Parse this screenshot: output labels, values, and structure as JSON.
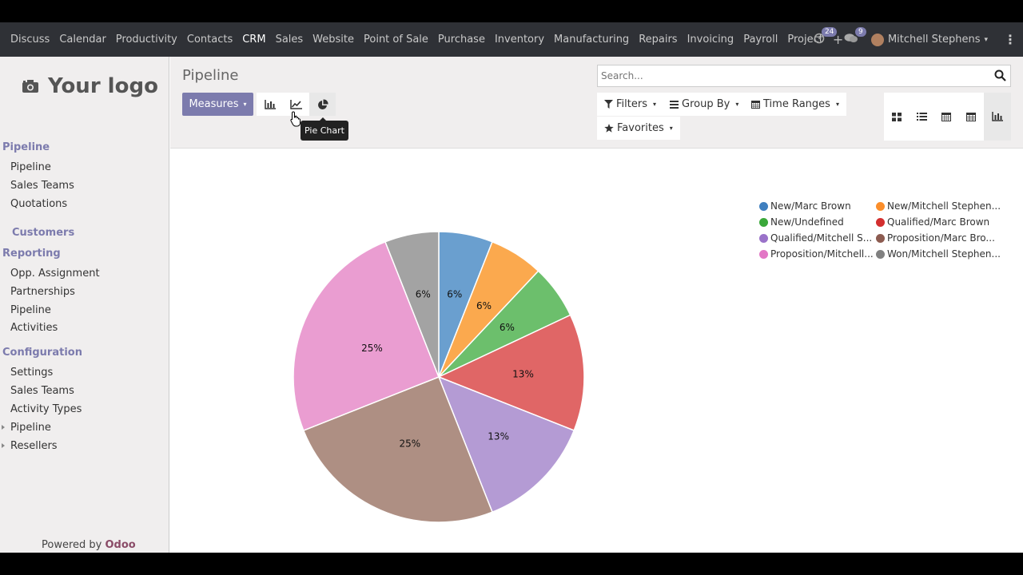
{
  "nav": {
    "menu": [
      "Discuss",
      "Calendar",
      "Productivity",
      "Contacts",
      "CRM",
      "Sales",
      "Website",
      "Point of Sale",
      "Purchase",
      "Inventory",
      "Manufacturing",
      "Repairs",
      "Invoicing",
      "Payroll",
      "Project"
    ],
    "active": "CRM",
    "plus_label": "+",
    "activity_count": "24",
    "message_count": "9",
    "user_name": "Mitchell Stephens",
    "caret": "▾",
    "more": "⋮"
  },
  "sidebar": {
    "logo_text": "Your logo",
    "sections": [
      {
        "label": "Pipeline",
        "items": [
          "Pipeline",
          "Sales Teams",
          "Quotations"
        ]
      },
      {
        "label": "Customers",
        "items": []
      },
      {
        "label": "Reporting",
        "items": [
          "Opp. Assignment",
          "Partnerships",
          "Pipeline",
          "Activities"
        ]
      },
      {
        "label": "Configuration",
        "items": [
          "Settings",
          "Sales Teams",
          "Activity Types",
          "Pipeline",
          "Resellers"
        ]
      }
    ],
    "powered_prefix": "Powered by ",
    "powered_brand": "Odoo"
  },
  "control": {
    "title": "Pipeline",
    "measures_label": "Measures",
    "tooltip": "Pie Chart",
    "search_placeholder": "Search...",
    "filters_label": "Filters",
    "groupby_label": "Group By",
    "timeranges_label": "Time Ranges",
    "favorites_label": "Favorites"
  },
  "chart_data": {
    "type": "pie",
    "slices": [
      {
        "label": "New/Marc Brown",
        "percent": 6,
        "color": "#6a9fcf"
      },
      {
        "label": "New/Mitchell Stephen...",
        "percent": 6,
        "color": "#fba94e"
      },
      {
        "label": "New/Undefined",
        "percent": 6,
        "color": "#6cbf6c"
      },
      {
        "label": "Qualified/Marc Brown",
        "percent": 13,
        "color": "#e06666"
      },
      {
        "label": "Qualified/Mitchell S...",
        "percent": 13,
        "color": "#b49bd4"
      },
      {
        "label": "Proposition/Marc Bro...",
        "percent": 25,
        "color": "#ae8f83"
      },
      {
        "label": "Proposition/Mitchell...",
        "percent": 25,
        "color": "#ea9dd1"
      },
      {
        "label": "Won/Mitchell Stephen...",
        "percent": 6,
        "color": "#a3a3a3"
      }
    ],
    "legend": [
      {
        "label": "New/Marc Brown",
        "color": "#3f7fbf"
      },
      {
        "label": "New/Mitchell Stephen...",
        "color": "#fb8e2b"
      },
      {
        "label": "New/Undefined",
        "color": "#3aa83a"
      },
      {
        "label": "Qualified/Marc Brown",
        "color": "#d32f2f"
      },
      {
        "label": "Qualified/Mitchell S...",
        "color": "#9a72c9"
      },
      {
        "label": "Proposition/Marc Bro...",
        "color": "#8c5b50"
      },
      {
        "label": "Proposition/Mitchell...",
        "color": "#e277c5"
      },
      {
        "label": "Won/Mitchell Stephen...",
        "color": "#808080"
      }
    ],
    "legend_position": "top-right"
  }
}
